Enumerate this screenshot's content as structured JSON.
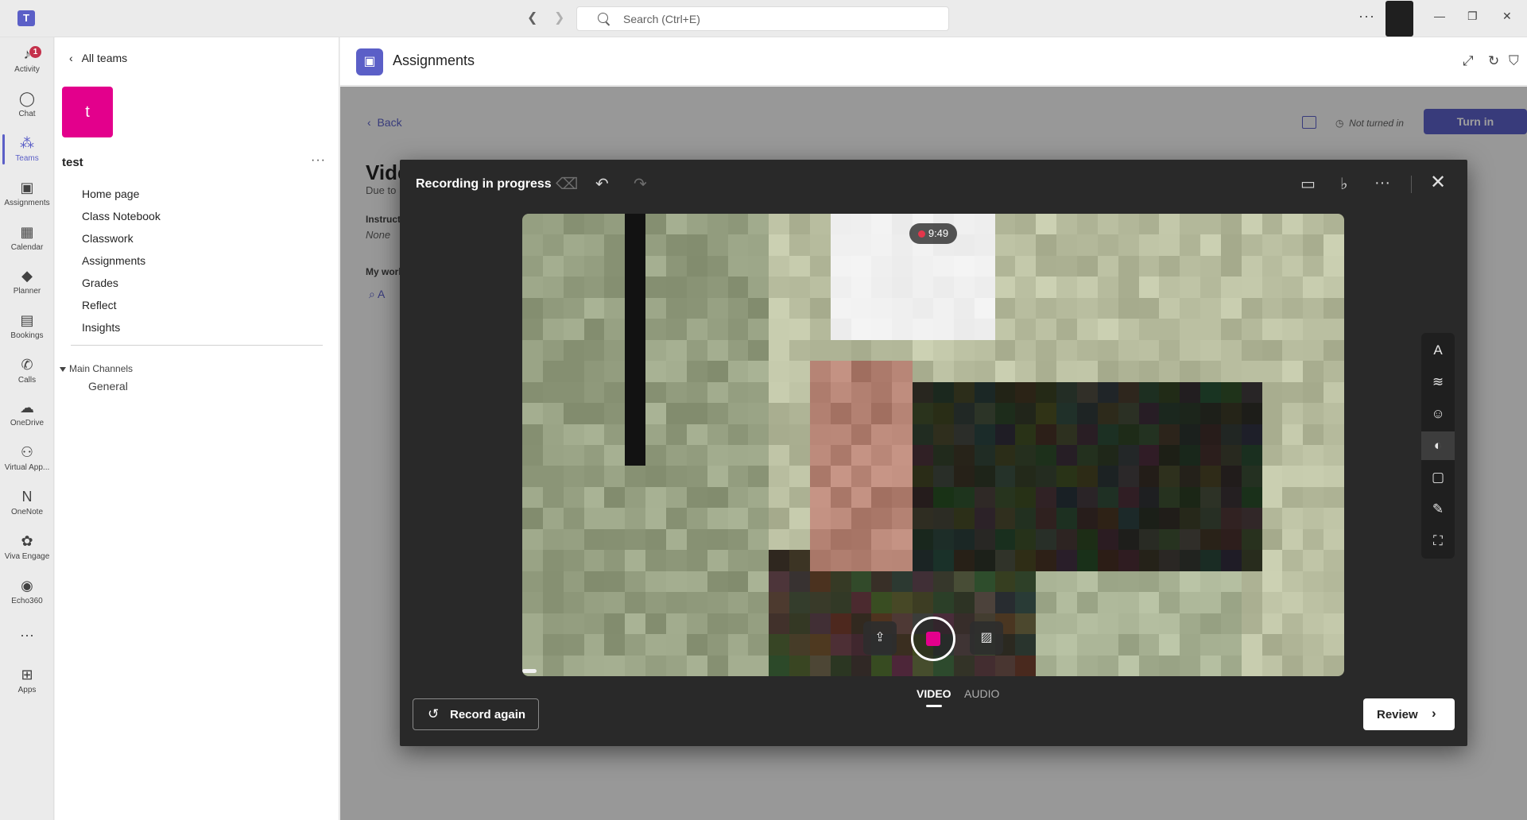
{
  "titlebar": {
    "search_placeholder": "Search (Ctrl+E)",
    "more": "···",
    "back_arrow": "❮",
    "forward_arrow": "❯",
    "minimize": "—",
    "restore": "❐",
    "close": "✕"
  },
  "rail": {
    "activity_badge": "1",
    "items": [
      {
        "label": "Activity",
        "icon": "bell-icon"
      },
      {
        "label": "Chat",
        "icon": "chat-icon"
      },
      {
        "label": "Teams",
        "icon": "teams-icon"
      },
      {
        "label": "Assignments",
        "icon": "backpack-icon"
      },
      {
        "label": "Calendar",
        "icon": "calendar-icon"
      },
      {
        "label": "Planner",
        "icon": "planner-icon"
      },
      {
        "label": "Bookings",
        "icon": "bookings-icon"
      },
      {
        "label": "Calls",
        "icon": "phone-icon"
      },
      {
        "label": "OneDrive",
        "icon": "cloud-icon"
      },
      {
        "label": "Virtual App...",
        "icon": "virtual-app-icon"
      },
      {
        "label": "OneNote",
        "icon": "onenote-icon"
      },
      {
        "label": "Viva Engage",
        "icon": "viva-engage-icon"
      },
      {
        "label": "Echo360",
        "icon": "echo360-icon"
      },
      {
        "label": "Apps",
        "icon": "plus-square-icon"
      }
    ]
  },
  "panel": {
    "all_teams": "All teams",
    "team_initial": "t",
    "team_name": "test",
    "more": "···",
    "channels": [
      "Home page",
      "Class Notebook",
      "Classwork",
      "Assignments",
      "Grades",
      "Reflect",
      "Insights"
    ],
    "main_channels": "Main Channels",
    "general": "General",
    "colors": {
      "team_tile": "#e3008c"
    }
  },
  "app": {
    "title": "Assignments",
    "back": "Back",
    "assignment_title_partial": "Vide",
    "due_partial": "Due to",
    "instructions_partial": "Instruct",
    "instructions_value": "None",
    "my_work_partial": "My work",
    "attach_partial": "A",
    "status": "Not turned in",
    "turn_in": "Turn in",
    "colors": {
      "accent": "#5b5fc7"
    }
  },
  "recorder": {
    "title": "Recording in progress",
    "timer": "9:49",
    "mode_video": "VIDEO",
    "mode_audio": "AUDIO",
    "active_mode": "VIDEO",
    "record_again": "Record again",
    "review": "Review",
    "side_tools": [
      "text-icon",
      "pen-icon",
      "sticker-icon",
      "filter-icon",
      "frame-icon",
      "board-icon",
      "backdrop-icon"
    ],
    "colors": {
      "record": "#e3008c",
      "recording_dot": "#e3364b"
    }
  }
}
